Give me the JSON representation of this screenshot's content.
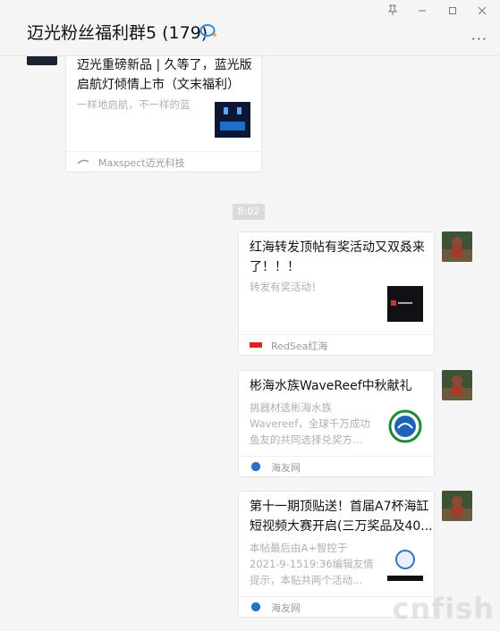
{
  "header": {
    "title": "迈光粉丝福利群5 (179)",
    "more": "···",
    "pin_icon": "pin-icon",
    "minimize_icon": "minimize-icon",
    "maximize_icon": "maximize-icon",
    "close_icon": "close-icon",
    "chat_icon": "chat-bubble-icon"
  },
  "time_badge": "8:02",
  "messages": [
    {
      "title_line1": "迈光重磅新品 | 久等了，蓝光版",
      "title_line2": "启航灯倾情上市（文末福利）",
      "desc": "一样地启航，不一样的蓝",
      "source": "Maxspect迈光科技"
    },
    {
      "title_line1": "红海转发顶帖有奖活动又双叒来",
      "title_line2": "了！！！",
      "desc": "转发有奖活动！",
      "source": "RedSea红海"
    },
    {
      "title_line1": "彬海水族WaveReef中秋献礼",
      "desc_line1": "挑器材选彬海水族",
      "desc_line2": "Wavereef，全球千万成功",
      "desc_line3": "鱼友的共同选择兑奖方...",
      "source": "海友网"
    },
    {
      "title_line1": "第十一期顶贴送！首届A7杯海缸",
      "title_line2": "短视频大赛开启(三万奖品及40...",
      "desc_line1": "本帖最后由A+智控于",
      "desc_line2": "2021-9-1519:36编辑友情",
      "desc_line3": "提示，本贴共两个活动...",
      "source": "海友网"
    }
  ],
  "watermark": "cnfish",
  "colors": {
    "accent": "#1aad19",
    "icon_blue": "#2e8ae6",
    "bg": "#f5f5f5"
  }
}
